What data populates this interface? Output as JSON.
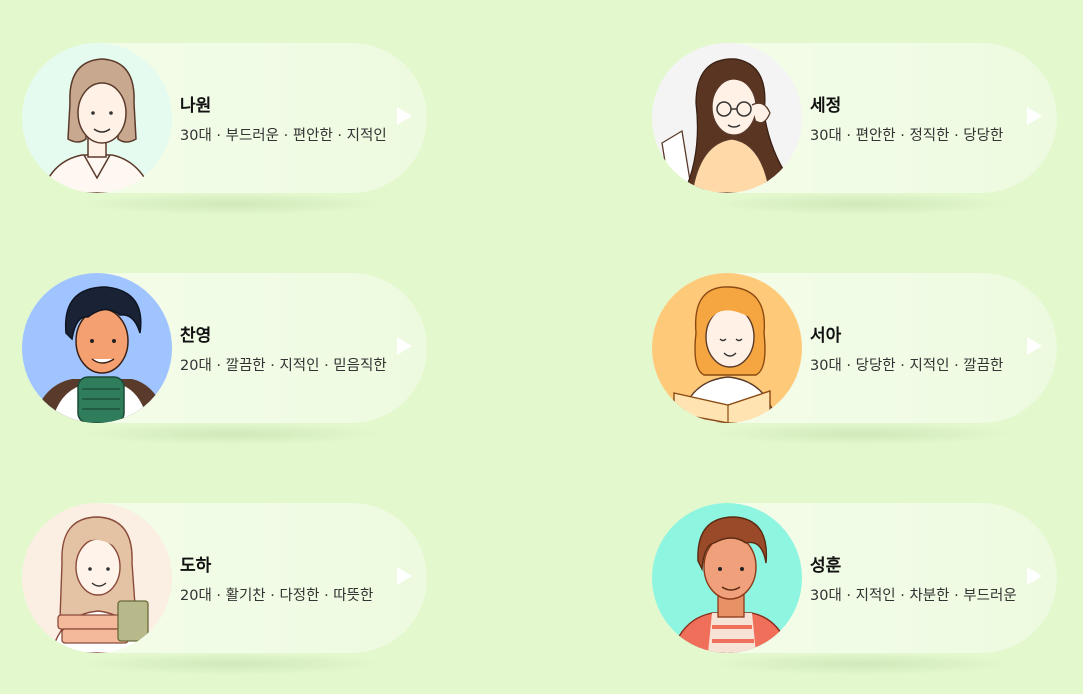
{
  "characters": [
    {
      "name": "나원",
      "tags": "30대 · 부드러운 · 편안한 · 지적인",
      "avatar_bg": "#e6fbef",
      "icon": "woman-short-hair-avatar"
    },
    {
      "name": "세정",
      "tags": "30대 · 편안한 · 정직한 · 당당한",
      "avatar_bg": "#f4f4f4",
      "icon": "woman-glasses-avatar"
    },
    {
      "name": "찬영",
      "tags": "20대 · 깔끔한 · 지적인 · 믿음직한",
      "avatar_bg": "#9fc4ff",
      "icon": "man-black-hair-avatar"
    },
    {
      "name": "서아",
      "tags": "30대 · 당당한 · 지적인 · 깔끔한",
      "avatar_bg": "#ffc97a",
      "icon": "woman-reading-avatar"
    },
    {
      "name": "도하",
      "tags": "20대 · 활기찬 · 다정한 · 따뜻한",
      "avatar_bg": "#fbeee2",
      "icon": "woman-books-avatar"
    },
    {
      "name": "성훈",
      "tags": "30대 · 지적인 · 차분한 · 부드러운",
      "avatar_bg": "#8ef5e0",
      "icon": "man-brown-hair-avatar"
    }
  ],
  "colors": {
    "background": "#e3f8cd",
    "play": "#ffffff"
  }
}
